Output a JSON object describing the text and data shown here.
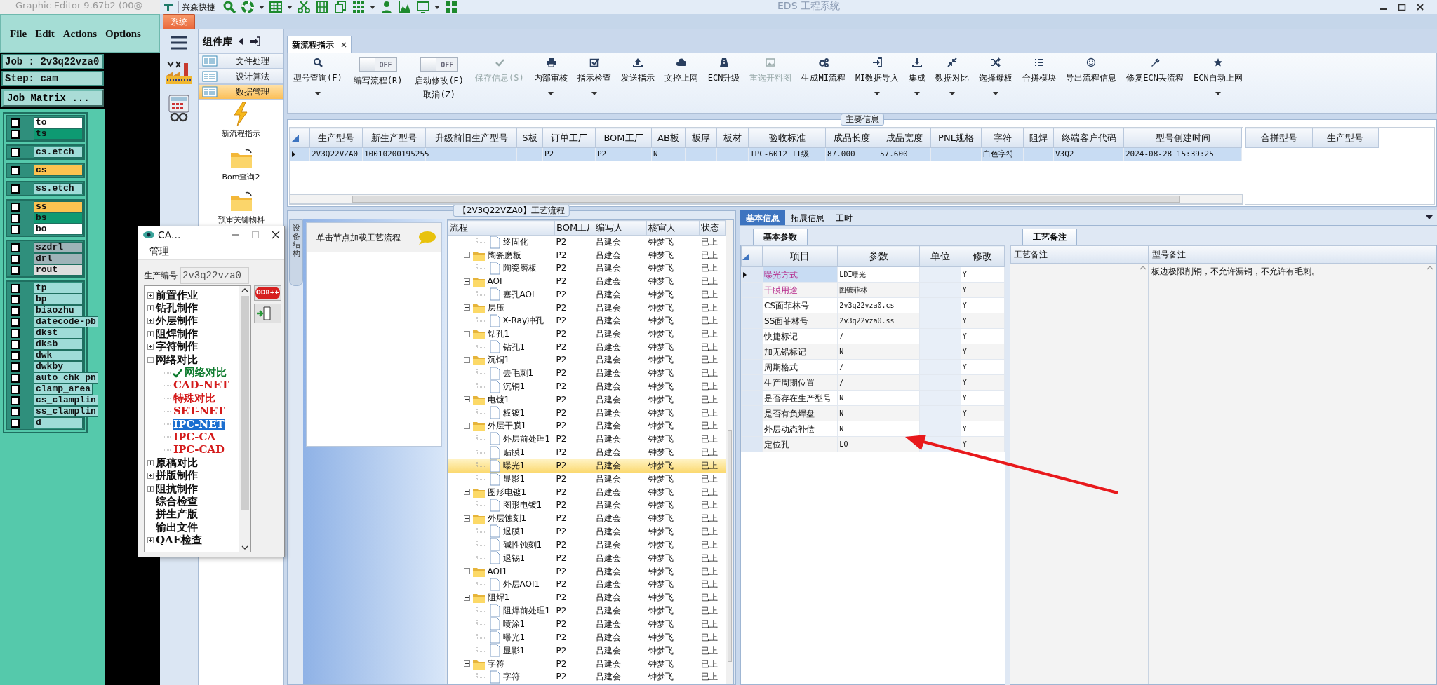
{
  "editor": {
    "title": "Graphic Editor 9.67b2 (00@",
    "menu": [
      "File",
      "Edit",
      "Actions",
      "Options"
    ],
    "job": "Job : 2v3q22vza0",
    "step": "Step: cam",
    "job_matrix": "Job Matrix ...",
    "layer_groups": [
      [
        {
          "name": "to",
          "color": "#ffffff",
          "checked": false
        },
        {
          "name": "ts",
          "color": "#0e9a72",
          "checked": false
        }
      ],
      [
        {
          "name": "cs.etch",
          "color": "#9fdcd8",
          "checked": false
        }
      ],
      [
        {
          "name": "cs",
          "color": "#fcc350",
          "checked": false
        }
      ],
      [
        {
          "name": "ss.etch",
          "color": "#9fdcd8",
          "checked": false
        }
      ],
      [
        {
          "name": "ss",
          "color": "#fcc350",
          "checked": false
        },
        {
          "name": "bs",
          "color": "#0e9a72",
          "checked": false
        },
        {
          "name": "bo",
          "color": "#ffffff",
          "checked": false
        }
      ],
      [
        {
          "name": "szdrl",
          "color": "#9fb3b8",
          "checked": false
        },
        {
          "name": "drl",
          "color": "#9fb3b8",
          "checked": false
        },
        {
          "name": "rout",
          "color": "#dedede",
          "checked": false
        }
      ],
      [
        {
          "name": "tp",
          "color": "#9fdcd8",
          "checked": false
        },
        {
          "name": "bp",
          "color": "#9fdcd8",
          "checked": false
        },
        {
          "name": "biaozhu",
          "color": "#9fdcd8",
          "checked": false
        },
        {
          "name": "datecode-pb",
          "color": "#9fdcd8",
          "checked": false
        },
        {
          "name": "dkst",
          "color": "#9fdcd8",
          "checked": false
        },
        {
          "name": "dksb",
          "color": "#9fdcd8",
          "checked": false
        },
        {
          "name": "dwk",
          "color": "#9fdcd8",
          "checked": false
        },
        {
          "name": "dwkby",
          "color": "#9fdcd8",
          "checked": false
        },
        {
          "name": "auto_chk_pn",
          "color": "#9fdcd8",
          "checked": false
        },
        {
          "name": "clamp_area",
          "color": "#9fdcd8",
          "checked": false
        },
        {
          "name": "cs_clamplin",
          "color": "#9fdcd8",
          "checked": false
        },
        {
          "name": "ss_clamplin",
          "color": "#9fdcd8",
          "checked": false
        },
        {
          "name": "d",
          "color": "#9fdcd8",
          "checked": false
        }
      ]
    ]
  },
  "eds": {
    "title": "EDS 工程系统",
    "quick_access": "兴森快捷",
    "app_tab": "系统",
    "library": {
      "title": "组件库",
      "categories": [
        {
          "label": "文件处理",
          "selected": false
        },
        {
          "label": "设计算法",
          "selected": false
        },
        {
          "label": "数据管理",
          "selected": true
        }
      ],
      "tools": [
        "新流程指示",
        "Bom查询2",
        "预审关键物料"
      ]
    },
    "doc_tabs": [
      {
        "label": "新流程指示",
        "selected": true
      }
    ],
    "ribbon": [
      {
        "kind": "button",
        "label": "型号查询(F)",
        "dropdown": true,
        "disabled": false
      },
      {
        "kind": "toggle",
        "label": "编写流程(R)",
        "switch_text": "OFF",
        "on": false
      },
      {
        "kind": "toggle",
        "label": "启动修改(E)",
        "second_line": "取消(Z)",
        "switch_text": "OFF",
        "on": false
      },
      {
        "kind": "button",
        "label": "保存信息(S)",
        "dropdown": false,
        "disabled": true
      },
      {
        "kind": "button",
        "label": "内部审核",
        "dropdown": true,
        "disabled": false
      },
      {
        "kind": "button",
        "label": "指示检查",
        "dropdown": true,
        "disabled": false
      },
      {
        "kind": "button",
        "label": "发送指示",
        "dropdown": false,
        "disabled": false
      },
      {
        "kind": "button",
        "label": "文控上网",
        "dropdown": false,
        "disabled": false
      },
      {
        "kind": "button",
        "label": "ECN升级",
        "dropdown": false,
        "disabled": false
      },
      {
        "kind": "button",
        "label": "重选开料图",
        "dropdown": false,
        "disabled": true
      },
      {
        "kind": "button",
        "label": "生成MI流程",
        "dropdown": false,
        "disabled": false
      },
      {
        "kind": "button",
        "label": "MI数据导入",
        "dropdown": true,
        "disabled": false
      },
      {
        "kind": "button",
        "label": "集成",
        "dropdown": true,
        "disabled": false
      },
      {
        "kind": "button",
        "label": "数据对比",
        "dropdown": true,
        "disabled": false
      },
      {
        "kind": "button",
        "label": "选择母板",
        "dropdown": true,
        "disabled": false
      },
      {
        "kind": "button",
        "label": "合拼模块",
        "dropdown": false,
        "disabled": false
      },
      {
        "kind": "button",
        "label": "导出流程信息",
        "dropdown": false,
        "disabled": false
      },
      {
        "kind": "button",
        "label": "修复ECN丢流程",
        "dropdown": false,
        "disabled": false
      },
      {
        "kind": "button",
        "label": "ECN自动上网",
        "dropdown": true,
        "disabled": false
      }
    ],
    "main_info": {
      "title": "主要信息",
      "columns": [
        "生产型号",
        "新生产型号",
        "升级前旧生产型号",
        "S板",
        "订单工厂",
        "BOM工厂",
        "AB板",
        "板厚",
        "板材",
        "验收标准",
        "成品长度",
        "成品宽度",
        "PNL规格",
        "字符",
        "阻焊",
        "终端客户代码",
        "型号创建时间"
      ],
      "rows": [
        {
          "selected": true,
          "cells": [
            "2V3Q22VZA0",
            "10010200195255",
            null,
            null,
            "P2",
            "P2",
            "N",
            null,
            null,
            "IPC-6012 II级",
            "87.000",
            "57.600",
            null,
            "白色字符",
            null,
            "V3Q2",
            "2024-08-28 15:39:25"
          ]
        }
      ],
      "merge_columns": [
        "合拼型号",
        "生产型号"
      ]
    },
    "process": {
      "title": "【2V3Q22VZA0】工艺流程",
      "side_tab": "设备结构",
      "hint": "单击节点加载工艺流程",
      "columns": [
        "流程",
        "BOM工厂",
        "编写人",
        "核审人",
        "状态"
      ],
      "rows": [
        {
          "kind": "file",
          "label": "终固化",
          "bom": "P2",
          "writer": "吕建会",
          "reviewer": "钟梦飞",
          "status": "已上",
          "selected": false
        },
        {
          "kind": "folder",
          "label": "陶瓷磨板",
          "bom": "P2",
          "writer": "吕建会",
          "reviewer": "钟梦飞",
          "status": "已上",
          "selected": false,
          "children": [
            {
              "kind": "file",
              "label": "陶瓷磨板",
              "bom": "P2",
              "writer": "吕建会",
              "reviewer": "钟梦飞",
              "status": "已上",
              "selected": false
            }
          ]
        },
        {
          "kind": "folder",
          "label": "AOI",
          "bom": "P2",
          "writer": "吕建会",
          "reviewer": "钟梦飞",
          "status": "已上",
          "selected": false,
          "children": [
            {
              "kind": "file",
              "label": "塞孔AOI",
              "bom": "P2",
              "writer": "吕建会",
              "reviewer": "钟梦飞",
              "status": "已上",
              "selected": false
            }
          ]
        },
        {
          "kind": "folder",
          "label": "层压",
          "bom": "P2",
          "writer": "吕建会",
          "reviewer": "钟梦飞",
          "status": "已上",
          "selected": false,
          "children": [
            {
              "kind": "file",
              "label": "X-Ray冲孔",
              "bom": "P2",
              "writer": "吕建会",
              "reviewer": "钟梦飞",
              "status": "已上",
              "selected": false
            }
          ]
        },
        {
          "kind": "folder",
          "label": "钻孔1",
          "bom": "P2",
          "writer": "吕建会",
          "reviewer": "钟梦飞",
          "status": "已上",
          "selected": false,
          "children": [
            {
              "kind": "file",
              "label": "钻孔1",
              "bom": "P2",
              "writer": "吕建会",
              "reviewer": "钟梦飞",
              "status": "已上",
              "selected": false
            }
          ]
        },
        {
          "kind": "folder",
          "label": "沉铜1",
          "bom": "P2",
          "writer": "吕建会",
          "reviewer": "钟梦飞",
          "status": "已上",
          "selected": false,
          "children": [
            {
              "kind": "file",
              "label": "去毛刺1",
              "bom": "P2",
              "writer": "吕建会",
              "reviewer": "钟梦飞",
              "status": "已上",
              "selected": false
            },
            {
              "kind": "file",
              "label": "沉铜1",
              "bom": "P2",
              "writer": "吕建会",
              "reviewer": "钟梦飞",
              "status": "已上",
              "selected": false
            }
          ]
        },
        {
          "kind": "folder",
          "label": "电镀1",
          "bom": "P2",
          "writer": "吕建会",
          "reviewer": "钟梦飞",
          "status": "已上",
          "selected": false,
          "children": [
            {
              "kind": "file",
              "label": "板镀1",
              "bom": "P2",
              "writer": "吕建会",
              "reviewer": "钟梦飞",
              "status": "已上",
              "selected": false
            }
          ]
        },
        {
          "kind": "folder",
          "label": "外层干膜1",
          "bom": "P2",
          "writer": "吕建会",
          "reviewer": "钟梦飞",
          "status": "已上",
          "selected": false,
          "children": [
            {
              "kind": "file",
              "label": "外层前处理1",
              "bom": "P2",
              "writer": "吕建会",
              "reviewer": "钟梦飞",
              "status": "已上",
              "selected": false
            },
            {
              "kind": "file",
              "label": "贴膜1",
              "bom": "P2",
              "writer": "吕建会",
              "reviewer": "钟梦飞",
              "status": "已上",
              "selected": false
            },
            {
              "kind": "file",
              "label": "曝光1",
              "bom": "P2",
              "writer": "吕建会",
              "reviewer": "钟梦飞",
              "status": "已上",
              "selected": true
            },
            {
              "kind": "file",
              "label": "显影1",
              "bom": "P2",
              "writer": "吕建会",
              "reviewer": "钟梦飞",
              "status": "已上",
              "selected": false
            }
          ]
        },
        {
          "kind": "folder",
          "label": "图形电镀1",
          "bom": "P2",
          "writer": "吕建会",
          "reviewer": "钟梦飞",
          "status": "已上",
          "selected": false,
          "children": [
            {
              "kind": "file",
              "label": "图形电镀1",
              "bom": "P2",
              "writer": "吕建会",
              "reviewer": "钟梦飞",
              "status": "已上",
              "selected": false
            }
          ]
        },
        {
          "kind": "folder",
          "label": "外层蚀刻1",
          "bom": "P2",
          "writer": "吕建会",
          "reviewer": "钟梦飞",
          "status": "已上",
          "selected": false,
          "children": [
            {
              "kind": "file",
              "label": "退膜1",
              "bom": "P2",
              "writer": "吕建会",
              "reviewer": "钟梦飞",
              "status": "已上",
              "selected": false
            },
            {
              "kind": "file",
              "label": "碱性蚀刻1",
              "bom": "P2",
              "writer": "吕建会",
              "reviewer": "钟梦飞",
              "status": "已上",
              "selected": false
            },
            {
              "kind": "file",
              "label": "退锡1",
              "bom": "P2",
              "writer": "吕建会",
              "reviewer": "钟梦飞",
              "status": "已上",
              "selected": false
            }
          ]
        },
        {
          "kind": "folder",
          "label": "AOI1",
          "bom": "P2",
          "writer": "吕建会",
          "reviewer": "钟梦飞",
          "status": "已上",
          "selected": false,
          "children": [
            {
              "kind": "file",
              "label": "外层AOI1",
              "bom": "P2",
              "writer": "吕建会",
              "reviewer": "钟梦飞",
              "status": "已上",
              "selected": false
            }
          ]
        },
        {
          "kind": "folder",
          "label": "阻焊1",
          "bom": "P2",
          "writer": "吕建会",
          "reviewer": "钟梦飞",
          "status": "已上",
          "selected": false,
          "children": [
            {
              "kind": "file",
              "label": "阻焊前处理1",
              "bom": "P2",
              "writer": "吕建会",
              "reviewer": "钟梦飞",
              "status": "已上",
              "selected": false
            },
            {
              "kind": "file",
              "label": "喷涂1",
              "bom": "P2",
              "writer": "吕建会",
              "reviewer": "钟梦飞",
              "status": "已上",
              "selected": false
            },
            {
              "kind": "file",
              "label": "曝光1",
              "bom": "P2",
              "writer": "吕建会",
              "reviewer": "钟梦飞",
              "status": "已上",
              "selected": false
            },
            {
              "kind": "file",
              "label": "显影1",
              "bom": "P2",
              "writer": "吕建会",
              "reviewer": "钟梦飞",
              "status": "已上",
              "selected": false
            }
          ]
        },
        {
          "kind": "folder",
          "label": "字符",
          "bom": "P2",
          "writer": "吕建会",
          "reviewer": "钟梦飞",
          "status": "已上",
          "selected": false,
          "children": [
            {
              "kind": "file",
              "label": "字符",
              "bom": "P2",
              "writer": "吕建会",
              "reviewer": "钟梦飞",
              "status": "已上",
              "selected": false
            }
          ]
        }
      ]
    },
    "info_tabs": [
      {
        "label": "基本信息",
        "selected": true
      },
      {
        "label": "拓展信息",
        "selected": false
      },
      {
        "label": "工时",
        "selected": false
      }
    ],
    "params": {
      "tab": "基本参数",
      "columns": [
        "项目",
        "参数",
        "单位",
        "修改"
      ],
      "rows": [
        {
          "item": "曝光方式",
          "value": "LDI曝光",
          "modify": "Y",
          "highlighted": true,
          "selected": true
        },
        {
          "item": "干膜用途",
          "value": "图镀菲林",
          "modify": "Y",
          "highlighted": true,
          "selected": false
        },
        {
          "item": "CS面菲林号",
          "value": "2v3q22vza0.cs",
          "modify": "Y",
          "highlighted": false,
          "selected": false
        },
        {
          "item": "SS面菲林号",
          "value": "2v3q22vza0.ss",
          "modify": "Y",
          "highlighted": false,
          "selected": false
        },
        {
          "item": "快捷标记",
          "value": "/",
          "modify": "Y",
          "highlighted": false,
          "selected": false
        },
        {
          "item": "加无铅标记",
          "value": "N",
          "modify": "Y",
          "highlighted": false,
          "selected": false
        },
        {
          "item": "周期格式",
          "value": "/",
          "modify": "Y",
          "highlighted": false,
          "selected": false
        },
        {
          "item": "生产周期位置",
          "value": "/",
          "modify": "Y",
          "highlighted": false,
          "selected": false
        },
        {
          "item": "是否存在生产型号",
          "value": "N",
          "modify": "Y",
          "highlighted": false,
          "selected": false
        },
        {
          "item": "是否有负焊盘",
          "value": "N",
          "modify": "Y",
          "highlighted": false,
          "selected": false
        },
        {
          "item": "外层动态补偿",
          "value": "N",
          "modify": "Y",
          "highlighted": false,
          "selected": false
        },
        {
          "item": "定位孔",
          "value": "LO",
          "modify": "Y",
          "highlighted": false,
          "selected": false
        }
      ]
    },
    "notes": {
      "tab": "工艺备注",
      "columns": [
        "工艺备注",
        "型号备注"
      ],
      "model_note": "板边极限削铜，不允许漏铜，不允许有毛刺。"
    }
  },
  "cam_dialog": {
    "title": "CA...",
    "menu": "管理",
    "field_label": "生产编号",
    "job_value": "2v3q22vza0",
    "odb_label": "ODB++",
    "tree": [
      {
        "kind": "group",
        "label": "前置作业",
        "expanded": false
      },
      {
        "kind": "group",
        "label": "钻孔制作",
        "expanded": false
      },
      {
        "kind": "group",
        "label": "外层制作",
        "expanded": false
      },
      {
        "kind": "group",
        "label": "阻焊制作",
        "expanded": false
      },
      {
        "kind": "group",
        "label": "字符制作",
        "expanded": false
      },
      {
        "kind": "group",
        "label": "网络对比",
        "expanded": true,
        "children": [
          {
            "kind": "item",
            "label": "网络对比",
            "done": true,
            "selected": false
          },
          {
            "kind": "item",
            "label": "CAD-NET",
            "done": false,
            "selected": false
          },
          {
            "kind": "item",
            "label": "特殊对比",
            "done": false,
            "selected": false
          },
          {
            "kind": "item",
            "label": "SET-NET",
            "done": false,
            "selected": false
          },
          {
            "kind": "item",
            "label": "IPC-NET",
            "done": false,
            "selected": true
          },
          {
            "kind": "item",
            "label": "IPC-CA",
            "done": false,
            "selected": false
          },
          {
            "kind": "item",
            "label": "IPC-CAD",
            "done": false,
            "selected": false
          }
        ]
      },
      {
        "kind": "group",
        "label": "原稿对比",
        "expanded": false
      },
      {
        "kind": "group",
        "label": "拼版制作",
        "expanded": false
      },
      {
        "kind": "group",
        "label": "阻抗制作",
        "expanded": false
      },
      {
        "kind": "leaf",
        "label": "综合检查"
      },
      {
        "kind": "leaf",
        "label": "拼生产版"
      },
      {
        "kind": "leaf",
        "label": "输出文件"
      },
      {
        "kind": "group",
        "label": "QAE检查",
        "expanded": false
      }
    ]
  }
}
